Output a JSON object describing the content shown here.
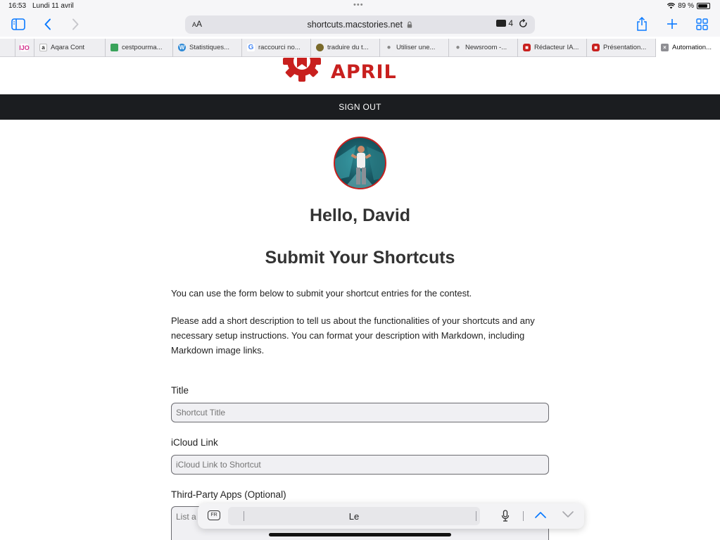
{
  "status_bar": {
    "time": "16:53",
    "date": "Lundi 11 avril",
    "battery": "89 %",
    "battery_level": 0.89
  },
  "toolbar": {
    "text_size_label": "AA",
    "url": "shortcuts.macstories.net",
    "tab_count": "4",
    "accent_color": "#0a7aff"
  },
  "bookmarks": [
    {
      "label": "",
      "icon": "todoist-icon",
      "color": "#d22c8a"
    },
    {
      "label": "Aqara Cont",
      "icon": "amazon-icon",
      "color": "#222222"
    },
    {
      "label": "cestpourma...",
      "icon": "green-site-icon",
      "color": "#3aa35b"
    },
    {
      "label": "Statistiques...",
      "icon": "wordpress-icon",
      "color": "#2f8ad6"
    },
    {
      "label": "raccourci no...",
      "icon": "google-icon",
      "color": "#4285f4"
    },
    {
      "label": "traduire du t...",
      "icon": "reverso-icon",
      "color": "#7a6a2a"
    },
    {
      "label": "Utiliser une...",
      "icon": "apple-icon",
      "color": "#888888"
    },
    {
      "label": "Newsroom -...",
      "icon": "apple-icon",
      "color": "#888888"
    },
    {
      "label": "Rédacteur IA...",
      "icon": "red-app-icon",
      "color": "#c8201e"
    },
    {
      "label": "Présentation...",
      "icon": "red-app-icon",
      "color": "#c8201e"
    },
    {
      "label": "Automation...",
      "icon": "close-tab-icon",
      "color": "#777777"
    }
  ],
  "site": {
    "logo_text": "APRIL",
    "brand_color": "#c8201e",
    "nav_signout": "SIGN OUT"
  },
  "main": {
    "greeting": "Hello, David",
    "heading": "Submit Your Shortcuts",
    "paragraph1": "You can use the form below to submit your shortcut entries for the contest.",
    "paragraph2": "Please add a short description to tell us about the functionalities of your shortcuts and any necessary setup instructions. You can format your description with Markdown, including Markdown image links."
  },
  "form": {
    "title_label": "Title",
    "title_placeholder": "Shortcut Title",
    "icloud_label": "iCloud Link",
    "icloud_placeholder": "iCloud Link to Shortcut",
    "apps_label": "Third-Party Apps (Optional)",
    "apps_placeholder": "List a"
  },
  "keyboard_bar": {
    "language": "FR",
    "suggestion": "Le"
  }
}
